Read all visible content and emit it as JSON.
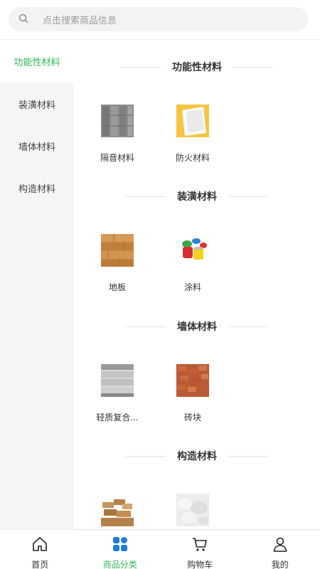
{
  "search": {
    "placeholder": "点击搜索商品信息"
  },
  "sidebar": {
    "items": [
      {
        "label": "功能性材料",
        "active": true
      },
      {
        "label": "装潢材料",
        "active": false
      },
      {
        "label": "墙体材料",
        "active": false
      },
      {
        "label": "构造材料",
        "active": false
      }
    ]
  },
  "sections": [
    {
      "title": "功能性材料",
      "products": [
        {
          "name": "隔音材料"
        },
        {
          "name": "防火材料"
        }
      ]
    },
    {
      "title": "装潢材料",
      "products": [
        {
          "name": "地板"
        },
        {
          "name": "涂料"
        }
      ]
    },
    {
      "title": "墙体材料",
      "products": [
        {
          "name": "轻质复合..."
        },
        {
          "name": "砖块"
        }
      ]
    },
    {
      "title": "构造材料",
      "products": [
        {
          "name": ""
        },
        {
          "name": ""
        }
      ]
    }
  ],
  "tabbar": {
    "tabs": [
      {
        "label": "首页",
        "icon": "home-icon"
      },
      {
        "label": "商品分类",
        "icon": "category-icon"
      },
      {
        "label": "购物车",
        "icon": "cart-icon"
      },
      {
        "label": "我的",
        "icon": "user-icon"
      }
    ]
  },
  "colors": {
    "accent": "#32b957",
    "sidebar_bg": "#f5f5f5",
    "category_icon": "#1e7ed8"
  }
}
